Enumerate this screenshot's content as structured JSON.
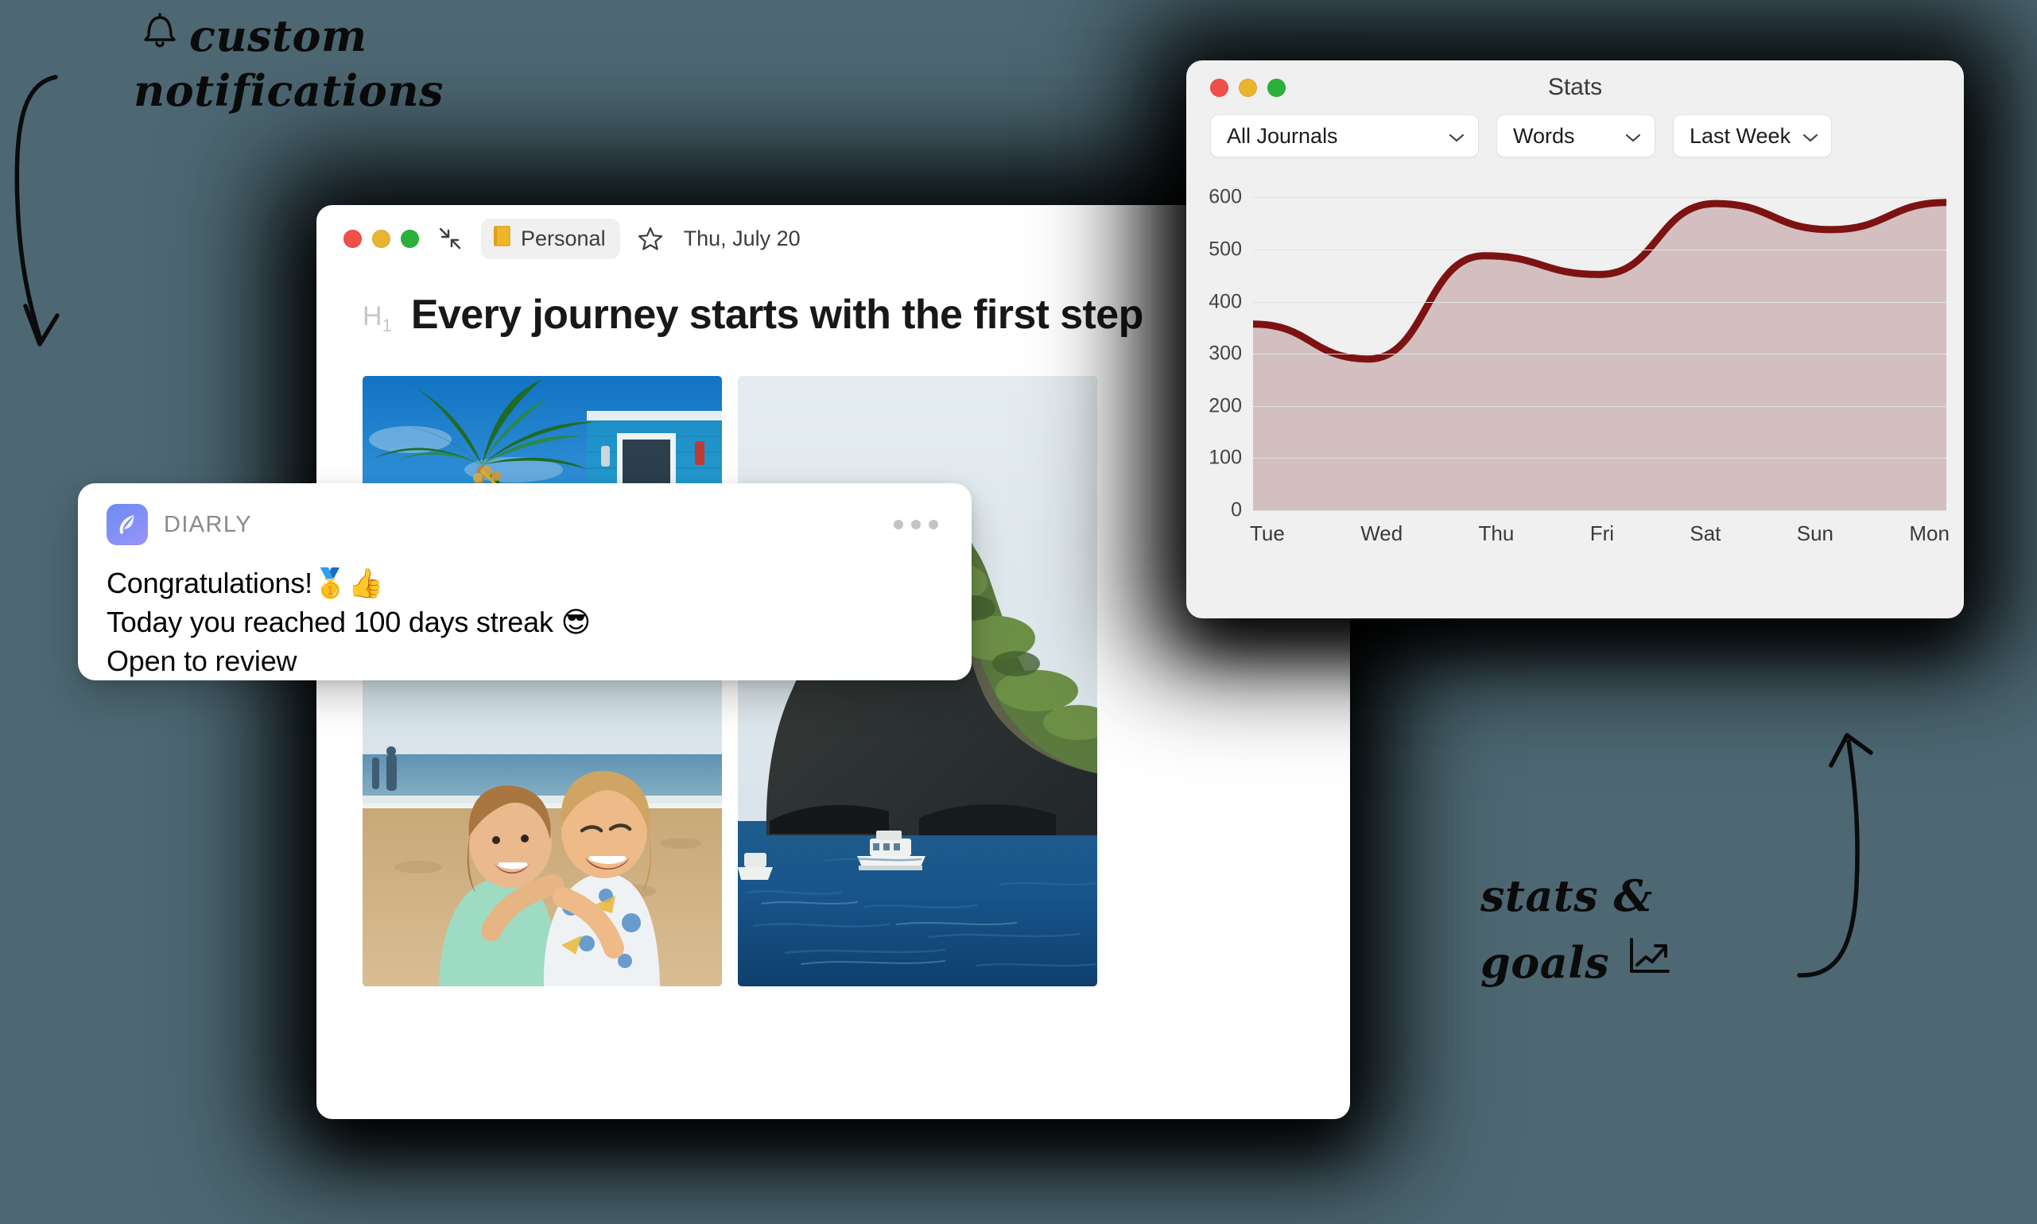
{
  "page": {
    "background_color": "#4d6873"
  },
  "annotations": [
    {
      "id": "custom-notifications",
      "icon": "bell-icon",
      "line1": "custom",
      "line2": "notifications",
      "arrow": "curved-arrow-down-left"
    },
    {
      "id": "stats-goals",
      "icon": "trending-up-chart-icon",
      "line1": "stats &",
      "line2": "goals",
      "arrow": "curved-arrow-up-right"
    }
  ],
  "editor_window": {
    "traffic_lights": {
      "close_color": "#f0504a",
      "minimize_color": "#eab430",
      "maximize_color": "#2cb03c"
    },
    "toolbar": {
      "focus_mode_icon": "collapse-arrows-icon",
      "journal_chip": {
        "icon": "orange-notebook-icon",
        "label": "Personal"
      },
      "favorite_icon": "star-outline-icon",
      "date": "Thu, July 20",
      "settings_icon": "sliders-icon"
    },
    "document": {
      "heading_tag": "H1",
      "heading": "Every journey starts with the first step",
      "photos": [
        {
          "name": "photo-beach-house",
          "alt": "Palm tree beside a blue beach house under a bright sky"
        },
        {
          "name": "photo-kids-beach",
          "alt": "Two smiling children hugging on a sandy beach at golden hour"
        },
        {
          "name": "photo-island",
          "alt": "Green limestone island cliff rising from deep blue sea with boats"
        }
      ]
    }
  },
  "notification": {
    "app_icon": "diarly-feather-icon",
    "app_name": "DIARLY",
    "more_icon": "more-dots-icon",
    "line1_text": "Congratulations!",
    "line1_emoji": "🥇👍",
    "line2_text": "Today you reached 100 days streak",
    "line2_emoji": "😎",
    "line3": "Open to review"
  },
  "stats_window": {
    "title": "Stats",
    "traffic_lights": {
      "close_color": "#f0504a",
      "minimize_color": "#eab430",
      "maximize_color": "#2cb03c"
    },
    "filters": [
      {
        "name": "journal-select",
        "value": "All Journals"
      },
      {
        "name": "metric-select",
        "value": "Words"
      },
      {
        "name": "range-select",
        "value": "Last Week"
      }
    ]
  },
  "chart_data": {
    "type": "area",
    "title": "Stats",
    "xlabel": "",
    "ylabel": "",
    "categories": [
      "Tue",
      "Wed",
      "Thu",
      "Fri",
      "Sat",
      "Sun",
      "Mon"
    ],
    "values": [
      357,
      290,
      488,
      452,
      588,
      538,
      590
    ],
    "yticks": [
      0,
      100,
      200,
      300,
      400,
      500,
      600
    ],
    "ylim": [
      0,
      640
    ],
    "grid": true,
    "legend": "none",
    "line_color": "#7d1212",
    "fill_color": "#d3bfbf",
    "smoothing": "monotone-spline"
  }
}
